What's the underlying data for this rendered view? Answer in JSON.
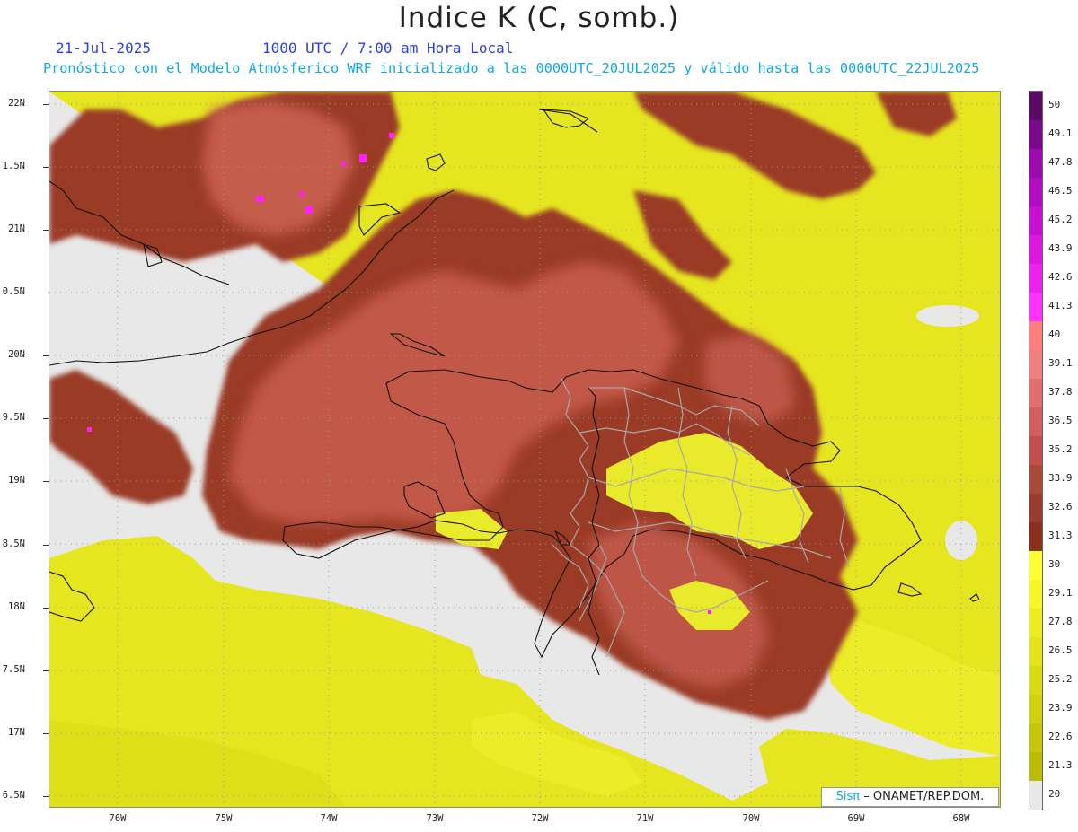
{
  "title": "Indice K (C, somb.)",
  "date": "21-Jul-2025",
  "time": "1000 UTC / 7:00 am Hora Local",
  "subtitle": "Pronóstico con el Modelo Atmósferico WRF inicializado a las 0000UTC_20JUL2025 y válido hasta las  0000UTC_22JUL2025",
  "lat_labels": [
    "22N",
    "1.5N",
    "21N",
    "0.5N",
    "20N",
    "9.5N",
    "19N",
    "8.5N",
    "18N",
    "7.5N",
    "17N",
    "6.5N"
  ],
  "lon_labels": [
    "76W",
    "75W",
    "74W",
    "73W",
    "72W",
    "71W",
    "70W",
    "69W",
    "68W"
  ],
  "colorbar": {
    "labels": [
      "50",
      "49.1",
      "47.8",
      "46.5",
      "45.2",
      "43.9",
      "42.6",
      "41.3",
      "40",
      "39.1",
      "37.8",
      "36.5",
      "35.2",
      "33.9",
      "32.6",
      "31.3",
      "30",
      "29.1",
      "27.8",
      "26.5",
      "25.2",
      "23.9",
      "22.6",
      "21.3",
      "20"
    ],
    "colors": [
      "#5a0a64",
      "#7a0a8c",
      "#9a0aac",
      "#b20cc0",
      "#c810d0",
      "#dc18dc",
      "#ee22ee",
      "#ff33ff",
      "#ff7f7f",
      "#ee8080",
      "#e07070",
      "#d06060",
      "#c05050",
      "#a84a3a",
      "#983c30",
      "#8a3020",
      "#ffff33",
      "#f6f628",
      "#ecec20",
      "#e4e41a",
      "#dada14",
      "#d0d010",
      "#c6c60c",
      "#bcbc08",
      "#e8e8e8"
    ]
  },
  "credit": {
    "brand": "Sisπ",
    "text": "– ONAMET/REP.DOM."
  }
}
